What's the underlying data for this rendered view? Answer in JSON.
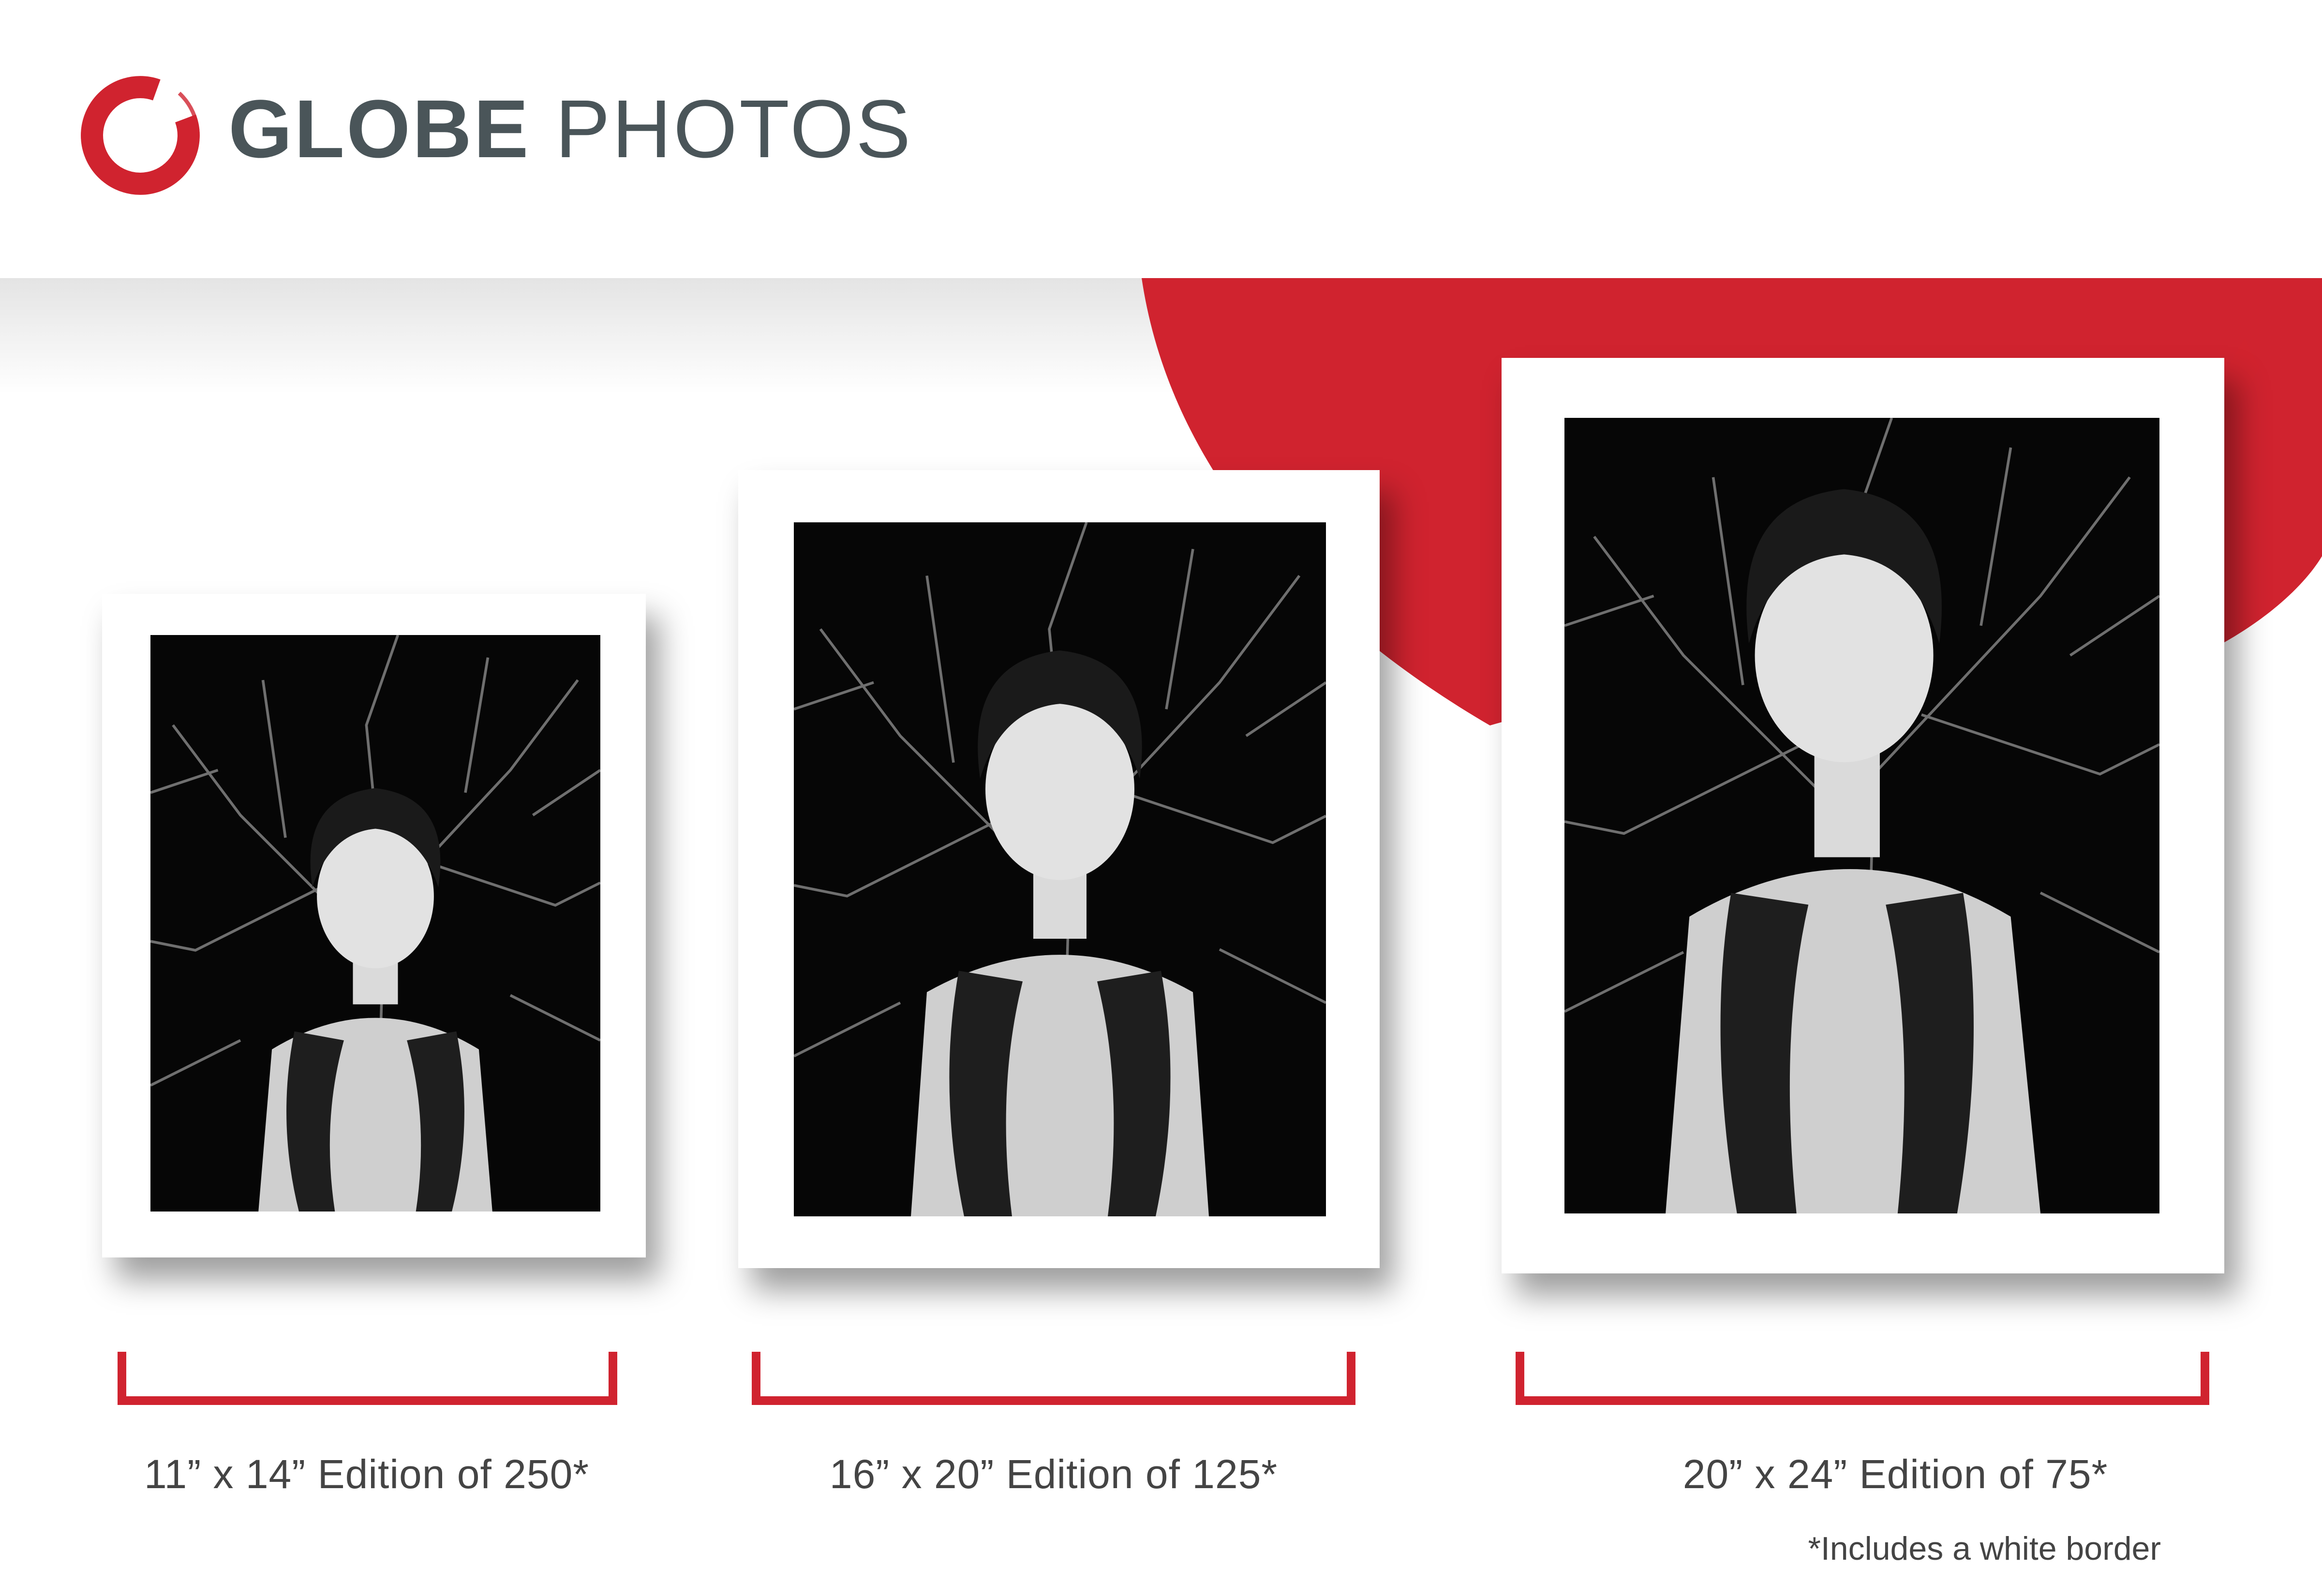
{
  "brand": {
    "name_bold": "GLOBE",
    "name_light": "PHOTOS",
    "logo_icon": "red-brush-circle-icon",
    "accent_color": "#d0232f",
    "text_color": "#4a5559"
  },
  "prints": [
    {
      "label": "11” x 14” Edition of 250*"
    },
    {
      "label": "16” x 20” Edition of 125*"
    },
    {
      "label": "20” x 24” Edition of 75*"
    }
  ],
  "footnote": "*Includes a white border"
}
